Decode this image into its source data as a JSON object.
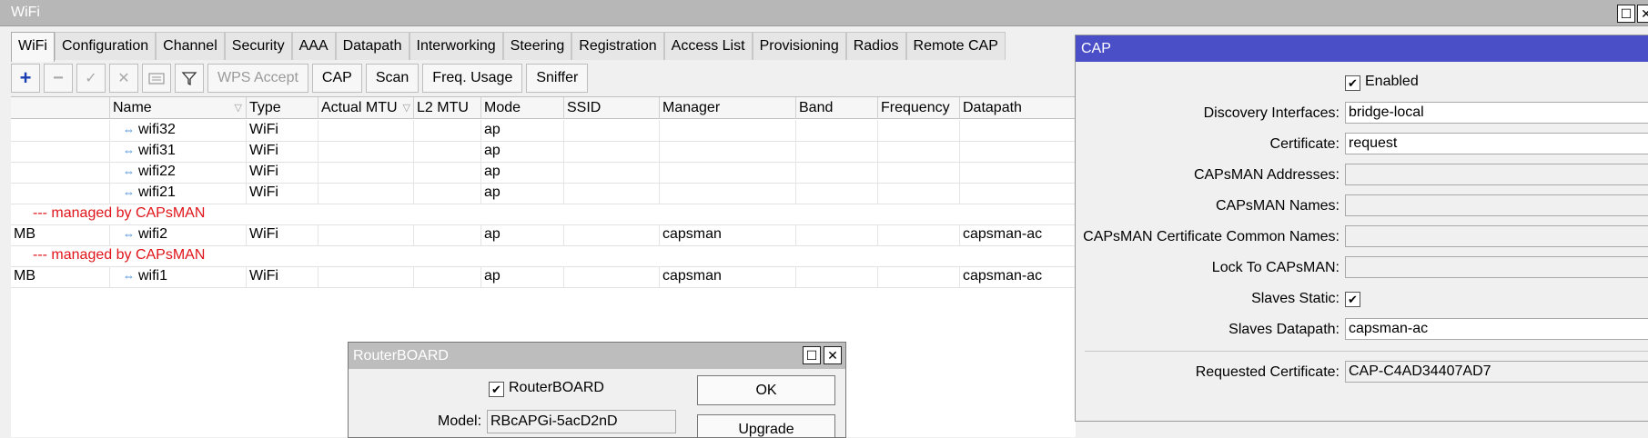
{
  "window": {
    "title": "WiFi"
  },
  "tabs": [
    "WiFi",
    "Configuration",
    "Channel",
    "Security",
    "AAA",
    "Datapath",
    "Interworking",
    "Steering",
    "Registration",
    "Access List",
    "Provisioning",
    "Radios",
    "Remote CAP"
  ],
  "toolbar": {
    "icons": [
      "add-icon",
      "remove-icon",
      "enable-icon",
      "disable-icon",
      "comment-icon",
      "filter-icon"
    ],
    "buttons": [
      "WPS Accept",
      "CAP",
      "Scan",
      "Freq. Usage",
      "Sniffer"
    ]
  },
  "table": {
    "headers": [
      "",
      "Name",
      "Type",
      "Actual MTU",
      "L2 MTU",
      "Mode",
      "SSID",
      "Manager",
      "Band",
      "Frequency",
      "Datapath"
    ],
    "rows": [
      {
        "flag": "",
        "name": "wifi32",
        "type": "WiFi",
        "mtu": "",
        "l2mtu": "",
        "mode": "ap",
        "ssid": "",
        "manager": "",
        "band": "",
        "freq": "",
        "datapath": ""
      },
      {
        "flag": "",
        "name": "wifi31",
        "type": "WiFi",
        "mtu": "",
        "l2mtu": "",
        "mode": "ap",
        "ssid": "",
        "manager": "",
        "band": "",
        "freq": "",
        "datapath": ""
      },
      {
        "flag": "",
        "name": "wifi22",
        "type": "WiFi",
        "mtu": "",
        "l2mtu": "",
        "mode": "ap",
        "ssid": "",
        "manager": "",
        "band": "",
        "freq": "",
        "datapath": ""
      },
      {
        "flag": "",
        "name": "wifi21",
        "type": "WiFi",
        "mtu": "",
        "l2mtu": "",
        "mode": "ap",
        "ssid": "",
        "manager": "",
        "band": "",
        "freq": "",
        "datapath": ""
      },
      {
        "comment": "--- managed by CAPsMAN"
      },
      {
        "flag": "MB",
        "name": "wifi2",
        "type": "WiFi",
        "mtu": "",
        "l2mtu": "",
        "mode": "ap",
        "ssid": "",
        "manager": "capsman",
        "band": "",
        "freq": "",
        "datapath": "capsman-ac"
      },
      {
        "comment": "--- managed by CAPsMAN"
      },
      {
        "flag": "MB",
        "name": "wifi1",
        "type": "WiFi",
        "mtu": "",
        "l2mtu": "",
        "mode": "ap",
        "ssid": "",
        "manager": "capsman",
        "band": "",
        "freq": "",
        "datapath": "capsman-ac"
      }
    ]
  },
  "cap": {
    "title": "CAP",
    "enabled_label": "Enabled",
    "discovery_label": "Discovery Interfaces:",
    "discovery_value": "bridge-local",
    "certificate_label": "Certificate:",
    "certificate_value": "request",
    "addresses_label": "CAPsMAN Addresses:",
    "names_label": "CAPsMAN Names:",
    "common_names_label": "CAPsMAN Certificate Common Names:",
    "lock_label": "Lock To CAPsMAN:",
    "slaves_static_label": "Slaves Static:",
    "slaves_datapath_label": "Slaves Datapath:",
    "slaves_datapath_value": "capsman-ac",
    "requested_cert_label": "Requested Certificate:",
    "requested_cert_value": "CAP-C4AD34407AD7"
  },
  "routerboard": {
    "title": "RouterBOARD",
    "checkbox_label": "RouterBOARD",
    "model_label": "Model:",
    "model_value": "RBcAPGi-5acD2nD",
    "ok_label": "OK",
    "upgrade_label": "Upgrade"
  },
  "colors": {
    "cap_title": "#4a4fc8",
    "comment": "#e0141a",
    "interface_icon": "#2f7fd6"
  }
}
